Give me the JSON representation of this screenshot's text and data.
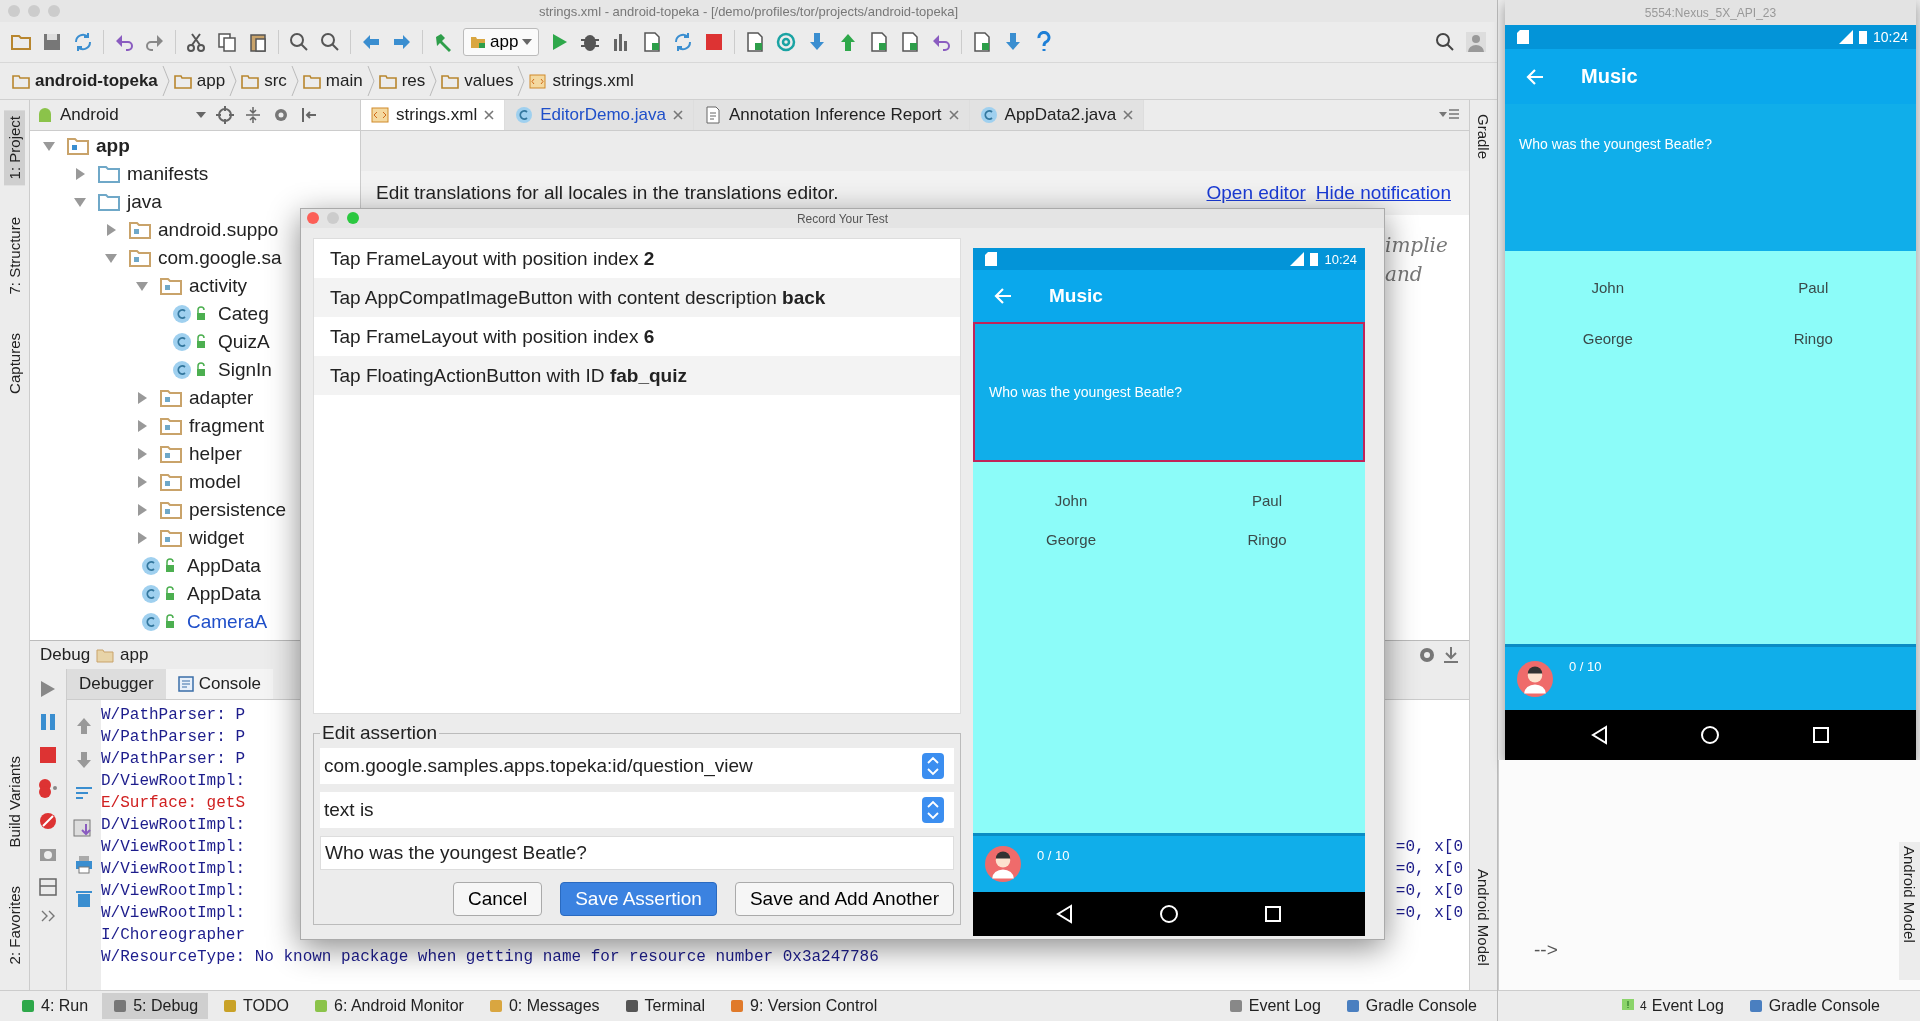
{
  "ide": {
    "title": "strings.xml - android-topeka - [/demo/profiles/tor/projects/android-topeka]",
    "run_config": "app",
    "breadcrumbs": [
      "android-topeka",
      "app",
      "src",
      "main",
      "res",
      "values",
      "strings.xml"
    ],
    "project_view": "Android",
    "left_tool_tabs_top": [
      {
        "label": "1: Project",
        "selected": true
      },
      {
        "label": "7: Structure",
        "selected": false
      },
      {
        "label": "Captures",
        "selected": false
      }
    ],
    "left_tool_tabs_bottom": [
      {
        "label": "Build Variants",
        "selected": false
      },
      {
        "label": "2: Favorites",
        "selected": false
      }
    ],
    "right_tool_tabs": [
      "Gradle",
      "Android Model"
    ],
    "tabs": [
      {
        "label": "strings.xml",
        "kind": "xml",
        "selected": true,
        "modified": false
      },
      {
        "label": "EditorDemo.java",
        "kind": "class",
        "selected": false,
        "modified": true
      },
      {
        "label": "Annotation Inference Report",
        "kind": "report",
        "selected": false,
        "modified": false
      },
      {
        "label": "AppData2.java",
        "kind": "class",
        "selected": false,
        "modified": false
      }
    ],
    "tree": [
      {
        "label": "app",
        "kind": "module",
        "expanded": true,
        "children": [
          {
            "label": "manifests",
            "kind": "folder",
            "expanded": false
          },
          {
            "label": "java",
            "kind": "folder",
            "expanded": true,
            "children": [
              {
                "label": "android.suppo",
                "kind": "package",
                "expanded": false
              },
              {
                "label": "com.google.sa",
                "kind": "package",
                "expanded": true,
                "children": [
                  {
                    "label": "activity",
                    "kind": "package",
                    "expanded": true,
                    "children": [
                      {
                        "label": "Categ",
                        "kind": "class",
                        "modified": false
                      },
                      {
                        "label": "QuizA",
                        "kind": "class",
                        "modified": false
                      },
                      {
                        "label": "SignIn",
                        "kind": "class",
                        "modified": false
                      }
                    ]
                  },
                  {
                    "label": "adapter",
                    "kind": "package",
                    "expanded": false
                  },
                  {
                    "label": "fragment",
                    "kind": "package",
                    "expanded": false
                  },
                  {
                    "label": "helper",
                    "kind": "package",
                    "expanded": false
                  },
                  {
                    "label": "model",
                    "kind": "package",
                    "expanded": false
                  },
                  {
                    "label": "persistence",
                    "kind": "package",
                    "expanded": false
                  },
                  {
                    "label": "widget",
                    "kind": "package",
                    "expanded": false
                  },
                  {
                    "label": "AppData",
                    "kind": "class",
                    "modified": false
                  },
                  {
                    "label": "AppData",
                    "kind": "class",
                    "modified": false
                  },
                  {
                    "label": "CameraA",
                    "kind": "class",
                    "modified": true
                  }
                ]
              }
            ]
          }
        ]
      }
    ],
    "notification": {
      "text": "Edit translations for all locales in the translations editor.",
      "links": [
        "Open editor",
        "Hide notification"
      ]
    },
    "code_fragments": [
      "implie",
      "and"
    ],
    "debug": {
      "title": "Debug",
      "config": "app",
      "tabs": [
        {
          "label": "Debugger",
          "selected": false
        },
        {
          "label": "Console",
          "selected": true
        }
      ],
      "console": [
        {
          "text": "W/PathParser: P",
          "kind": "warn"
        },
        {
          "text": "W/PathParser: P",
          "kind": "warn"
        },
        {
          "text": "W/PathParser: P",
          "kind": "warn"
        },
        {
          "text": "D/ViewRootImpl:",
          "kind": "debug"
        },
        {
          "text": "E/Surface: getS",
          "kind": "error"
        },
        {
          "text": "D/ViewRootImpl:",
          "kind": "debug"
        },
        {
          "text": "W/ViewRootImpl:",
          "kind": "warn",
          "tail": "=0, x[0"
        },
        {
          "text": "W/ViewRootImpl:",
          "kind": "warn",
          "tail": "=0, x[0"
        },
        {
          "text": "W/ViewRootImpl:",
          "kind": "warn",
          "tail": "=0, x[0"
        },
        {
          "text": "W/ViewRootImpl:",
          "kind": "warn",
          "tail": "=0, x[0"
        },
        {
          "text": "I/Choreographer",
          "kind": "info"
        },
        {
          "text": "W/ResourceType: No known package when getting name for resource number 0x3a247786",
          "kind": "warn"
        }
      ]
    },
    "status_bar": [
      {
        "label": "4: Run",
        "kind": "run",
        "selected": false
      },
      {
        "label": "5: Debug",
        "kind": "debug",
        "selected": true
      },
      {
        "label": "TODO",
        "kind": "todo",
        "selected": false
      },
      {
        "label": "6: Android Monitor",
        "kind": "android",
        "selected": false
      },
      {
        "label": "0: Messages",
        "kind": "messages",
        "selected": false
      },
      {
        "label": "Terminal",
        "kind": "terminal",
        "selected": false
      },
      {
        "label": "9: Version Control",
        "kind": "vcs",
        "selected": false
      }
    ],
    "status_bar_right": [
      {
        "label": "Event Log",
        "kind": "log"
      },
      {
        "label": "Gradle Console",
        "kind": "console"
      }
    ]
  },
  "dialog": {
    "title": "Record Your Test",
    "events": [
      "Tap FrameLayout with position index **2**",
      "Tap AppCompatImageButton with content description **back**",
      "Tap FrameLayout with position index **6**",
      "Tap FloatingActionButton with ID **fab_quiz**"
    ],
    "assertion": {
      "legend": "Edit assertion",
      "element": "com.google.samples.apps.topeka:id/question_view",
      "condition": "text is",
      "value": "Who was the youngest Beatle?"
    },
    "buttons": [
      {
        "label": "Cancel",
        "kind": "normal"
      },
      {
        "label": "Save Assertion",
        "kind": "default"
      },
      {
        "label": "Save and Add Another",
        "kind": "normal"
      }
    ],
    "preview": {
      "time": "10:24",
      "title": "Music",
      "question": "Who was the youngest Beatle?",
      "highlighted": true,
      "answers": [
        "John",
        "Paul",
        "George",
        "Ringo"
      ],
      "score": "0 / 10"
    }
  },
  "emulator": {
    "title": "5554:Nexus_5X_API_23",
    "screen": {
      "time": "10:24",
      "title": "Music",
      "question": "Who was the youngest Beatle?",
      "highlighted": false,
      "answers": [
        "John",
        "Paul",
        "George",
        "Ringo"
      ],
      "score": "0 / 10"
    },
    "behind": {
      "arrow": "-->",
      "tool_tab": "Android Model",
      "event_log": {
        "count": "4",
        "label": "Event Log"
      },
      "console": "Gradle Console"
    }
  }
}
